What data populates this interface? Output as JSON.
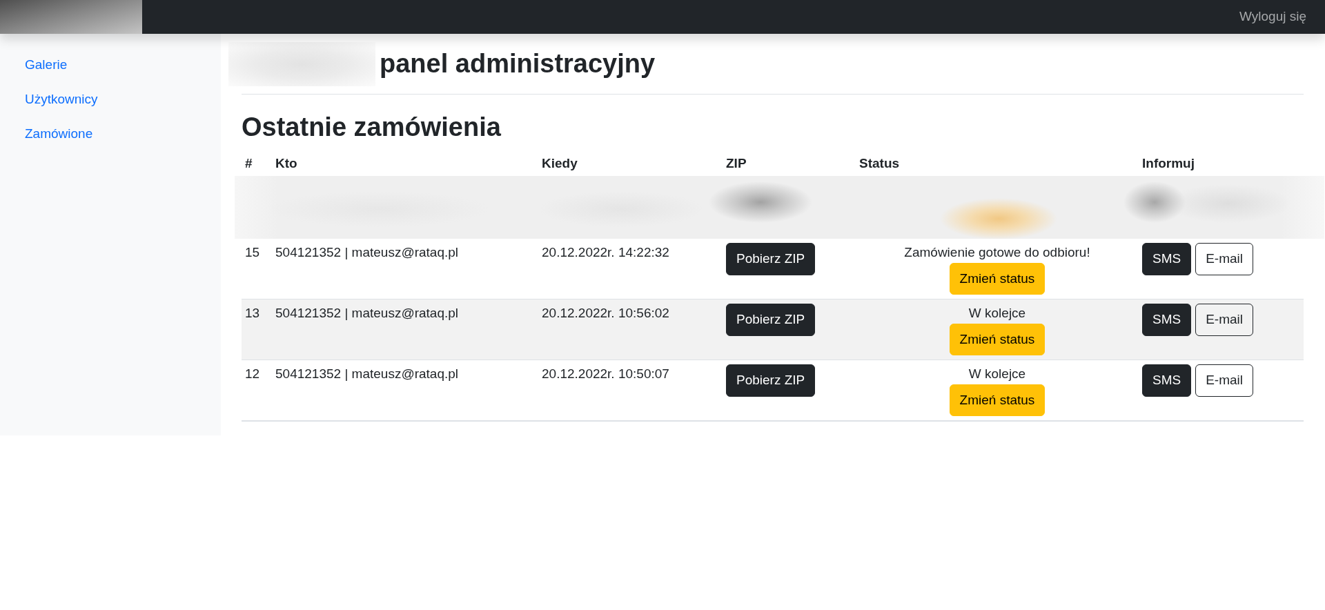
{
  "navbar": {
    "brand_blurred": true,
    "logout": "Wyloguj się"
  },
  "sidebar": {
    "items": [
      {
        "label": "Galerie"
      },
      {
        "label": "Użytkownicy"
      },
      {
        "label": "Zamówione"
      }
    ]
  },
  "header": {
    "title_prefix_blurred": true,
    "title": "panel administracyjny"
  },
  "orders": {
    "title": "Ostatnie zamówienia",
    "columns": [
      "#",
      "Kto",
      "Kiedy",
      "ZIP",
      "Status",
      "Informuj"
    ],
    "rows": [
      {
        "kind": "blurred"
      },
      {
        "kind": "order",
        "id": "15",
        "who": "504121352 | mateusz@rataq.pl",
        "when": "20.12.2022r. 14:22:32",
        "zip_button": "Pobierz ZIP",
        "status": "Zamówienie gotowe do odbioru!",
        "status_button": "Zmień status",
        "sms_button": "SMS",
        "email_button": "E-mail"
      },
      {
        "kind": "order",
        "id": "13",
        "who": "504121352 | mateusz@rataq.pl",
        "when": "20.12.2022r. 10:56:02",
        "zip_button": "Pobierz ZIP",
        "status": "W kolejce",
        "status_button": "Zmień status",
        "sms_button": "SMS",
        "email_button": "E-mail"
      },
      {
        "kind": "order",
        "id": "12",
        "who": "504121352 | mateusz@rataq.pl",
        "when": "20.12.2022r. 10:50:07",
        "zip_button": "Pobierz ZIP",
        "status": "W kolejce",
        "status_button": "Zmień status",
        "sms_button": "SMS",
        "email_button": "E-mail"
      }
    ]
  }
}
